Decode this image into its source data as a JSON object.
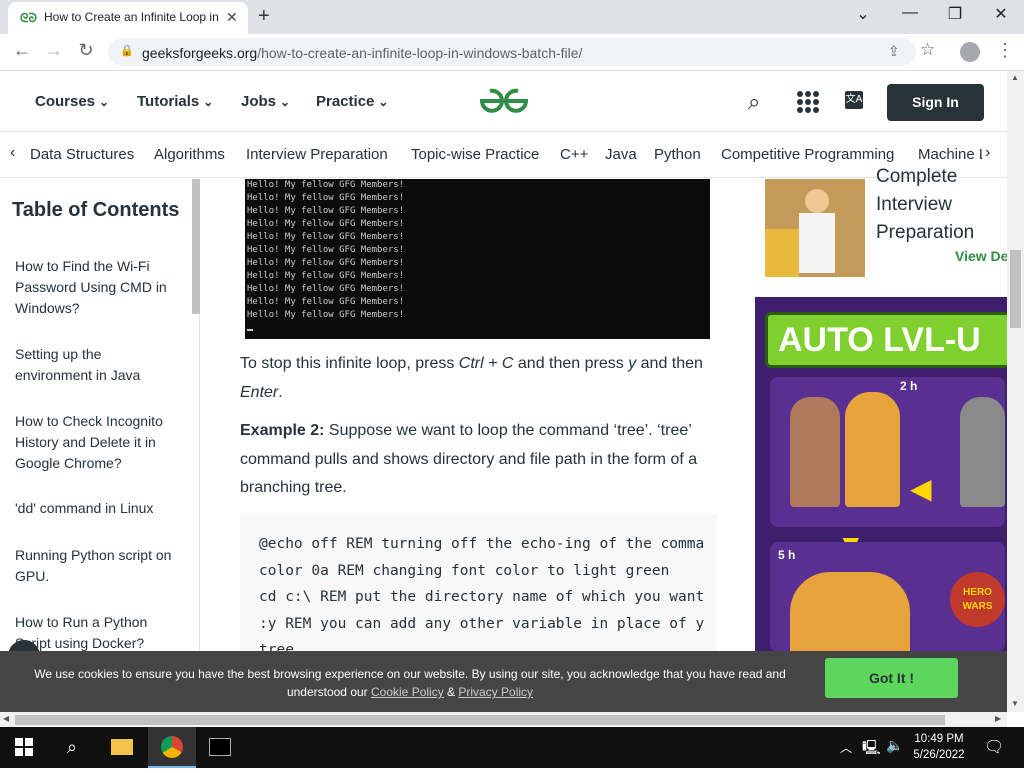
{
  "browser": {
    "tab_title": "How to Create an Infinite Loop in Windows Batch File",
    "favicon": "gfg-icon",
    "url_domain": "geeksforgeeks.org",
    "url_path": "/how-to-create-an-infinite-loop-in-windows-batch-file/"
  },
  "header": {
    "nav": [
      {
        "label": "Courses"
      },
      {
        "label": "Tutorials"
      },
      {
        "label": "Jobs"
      },
      {
        "label": "Practice"
      }
    ],
    "signin_label": "Sign In",
    "translate_glyph": "文A",
    "colors": {
      "brand": "#2f8d46",
      "dark": "#273239"
    }
  },
  "categories": [
    "Data Structures",
    "Algorithms",
    "Interview Preparation",
    "Topic-wise Practice",
    "C++",
    "Java",
    "Python",
    "Competitive Programming",
    "Machine L"
  ],
  "toc": {
    "title": "Table of Contents",
    "items": [
      "How to Find the Wi-Fi Password Using CMD in Windows?",
      "Setting up the environment in Java",
      "How to Check Incognito History and Delete it in Google Chrome?",
      "'dd' command in Linux",
      "Running Python script on GPU.",
      "How to Run a Python Script using Docker?"
    ]
  },
  "article": {
    "console_lines": [
      "Hello! My fellow GFG Members!",
      "Hello! My fellow GFG Members!",
      "Hello! My fellow GFG Members!",
      "Hello! My fellow GFG Members!",
      "Hello! My fellow GFG Members!",
      "Hello! My fellow GFG Members!",
      "Hello! My fellow GFG Members!",
      "Hello! My fellow GFG Members!",
      "Hello! My fellow GFG Members!",
      "Hello! My fellow GFG Members!",
      "Hello! My fellow GFG Members!"
    ],
    "stop_text_1": "To stop this infinite loop, press ",
    "stop_key": "Ctrl + C",
    "stop_text_2": " and then press ",
    "stop_y": "y",
    "stop_text_3": " and then ",
    "stop_enter": "Enter",
    "stop_text_4": ".",
    "example_label": "Example 2:",
    "example_text": " Suppose we want to loop the command ‘tree’. ‘tree’ command pulls and shows directory and file path in the form of a branching tree.",
    "code_lines": [
      "@echo off REM turning off the echo-ing of the comma",
      "color 0a REM changing font color to light green",
      "cd c:\\ REM put the directory name of which you want",
      ":y REM you can add any other variable in place of y",
      "tree"
    ]
  },
  "sidebar_ad": {
    "lines": [
      "Complete",
      "Interview",
      "Preparation"
    ],
    "link": "View De",
    "game_banner": "AUTO LVL-U",
    "timer_1": "2 h",
    "timer_2": "5 h",
    "game_logo": "HERO WARS"
  },
  "cookie": {
    "text_1": "We use cookies to ensure you have the best browsing experience on our website. By using our site, you acknowledge that you have read and understood our ",
    "cookie_policy": "Cookie Policy",
    "amp": " & ",
    "privacy_policy": "Privacy Policy",
    "button": "Got It !"
  },
  "taskbar": {
    "time": "10:49 PM",
    "date": "5/26/2022"
  }
}
